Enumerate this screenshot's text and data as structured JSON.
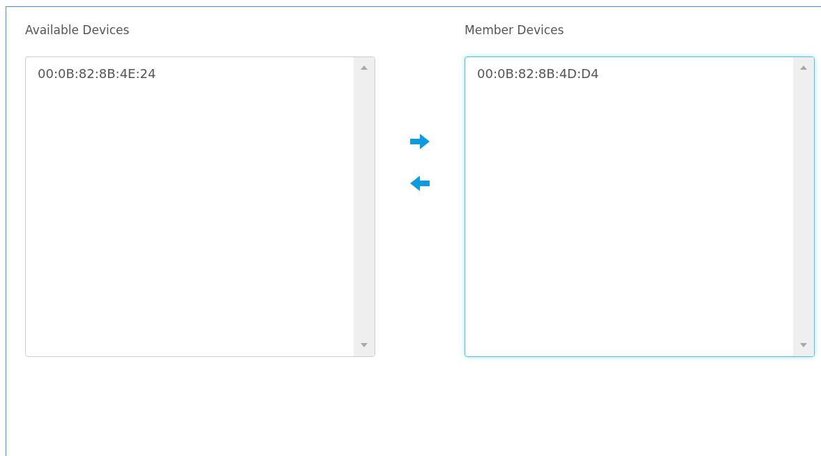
{
  "lists": [
    {
      "title": "Available Devices",
      "focused": false,
      "items": [
        {
          "label": "00:0B:82:8B:4E:24",
          "selected": false
        }
      ]
    },
    {
      "title": "Member Devices",
      "focused": true,
      "items": [
        {
          "label": "00:0B:82:8B:4D:D4",
          "selected": false
        }
      ]
    }
  ]
}
